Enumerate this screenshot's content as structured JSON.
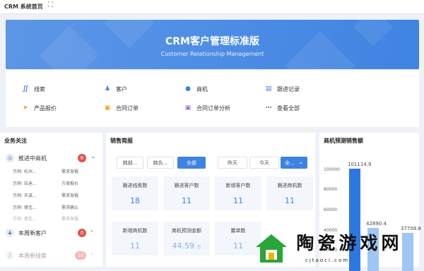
{
  "topbar": {
    "title": "CRM 系统首页",
    "expand_icon": "expand-icon"
  },
  "banner": {
    "title": "CRM客户管理标准版",
    "subtitle": "Customer Relationship Management"
  },
  "quick": [
    {
      "label": "线索",
      "icon": "clue-icon",
      "color": "#3f83e1",
      "glyph": "∬"
    },
    {
      "label": "客户",
      "icon": "customer-icon",
      "color": "#3f83e1",
      "glyph": "♟"
    },
    {
      "label": "商机",
      "icon": "opportunity-icon",
      "color": "#3f83e1",
      "glyph": "●"
    },
    {
      "label": "跟进记录",
      "icon": "followup-record-icon",
      "color": "#3f83e1",
      "glyph": "▤"
    },
    {
      "label": "产品报价",
      "icon": "quote-icon",
      "color": "#f0a020",
      "glyph": "➤"
    },
    {
      "label": "合同订单",
      "icon": "contract-order-icon",
      "color": "#f0a020",
      "glyph": "▣"
    },
    {
      "label": "合同订单分析",
      "icon": "contract-analysis-icon",
      "color": "#9a6fe0",
      "glyph": "▣"
    },
    {
      "label": "查看全部",
      "icon": "more-icon",
      "color": "#666666",
      "glyph": "⋯"
    }
  ],
  "business": {
    "title": "业务关注",
    "groups": [
      {
        "label": "推进中商机",
        "count": "6",
        "count_color": "#e05252",
        "arrow": "⌄"
      },
      {
        "label": "本周新客户",
        "count": "0",
        "count_color": "#e05252",
        "arrow": "›"
      },
      {
        "label": "本周新线索",
        "count": "10",
        "count_color": "#f2b8b8",
        "arrow": "›"
      }
    ],
    "examples": [
      {
        "a": "示例: 杭州...",
        "b": "需求发掘"
      },
      {
        "a": "示例: 伍迪...",
        "b": "方案报价"
      },
      {
        "a": "示例: 天诚...",
        "b": "需求发掘"
      },
      {
        "a": "示例: 德宝...",
        "b": "需求确认"
      },
      {
        "a": "示例: 德宝...",
        "b": "需求发掘"
      }
    ]
  },
  "sales": {
    "title": "销售简报",
    "filters": [
      "韩部...",
      "韩负...",
      "全部"
    ],
    "periods": [
      "昨天",
      "今天",
      "全..."
    ],
    "dropdown_arrow": "⌄",
    "cards": [
      {
        "label": "跟进线索数",
        "value": "18"
      },
      {
        "label": "跟进客户数",
        "value": "11"
      },
      {
        "label": "新增客户数",
        "value": "11"
      },
      {
        "label": "跟进商机数",
        "value": "11"
      },
      {
        "label": "新增商机数",
        "value": "11"
      },
      {
        "label": "商机预测金额",
        "value": "44.59",
        "unit": "万"
      },
      {
        "label": "赢单数",
        "value": "11"
      },
      {
        "label": "",
        "value": ""
      }
    ]
  },
  "forecast": {
    "title": "商机预测销售额",
    "chart_data": {
      "type": "bar",
      "yticks": [
        "100000",
        "80000",
        "60000",
        "40000",
        "20000"
      ],
      "ylim": [
        0,
        120000
      ],
      "values": [
        {
          "value": 101114.9,
          "label": "101114.9",
          "color": "#2d78e0"
        },
        {
          "value": 42890.4,
          "label": "42890.4",
          "color": "#9fc6f4"
        },
        {
          "value": 37708.8,
          "label": "37708.8",
          "color": "#9fc6f4"
        }
      ]
    }
  },
  "watermark": {
    "chars": [
      "陶",
      "瓷",
      "游",
      "戏",
      "网"
    ],
    "url": "cjtaoci.com"
  }
}
